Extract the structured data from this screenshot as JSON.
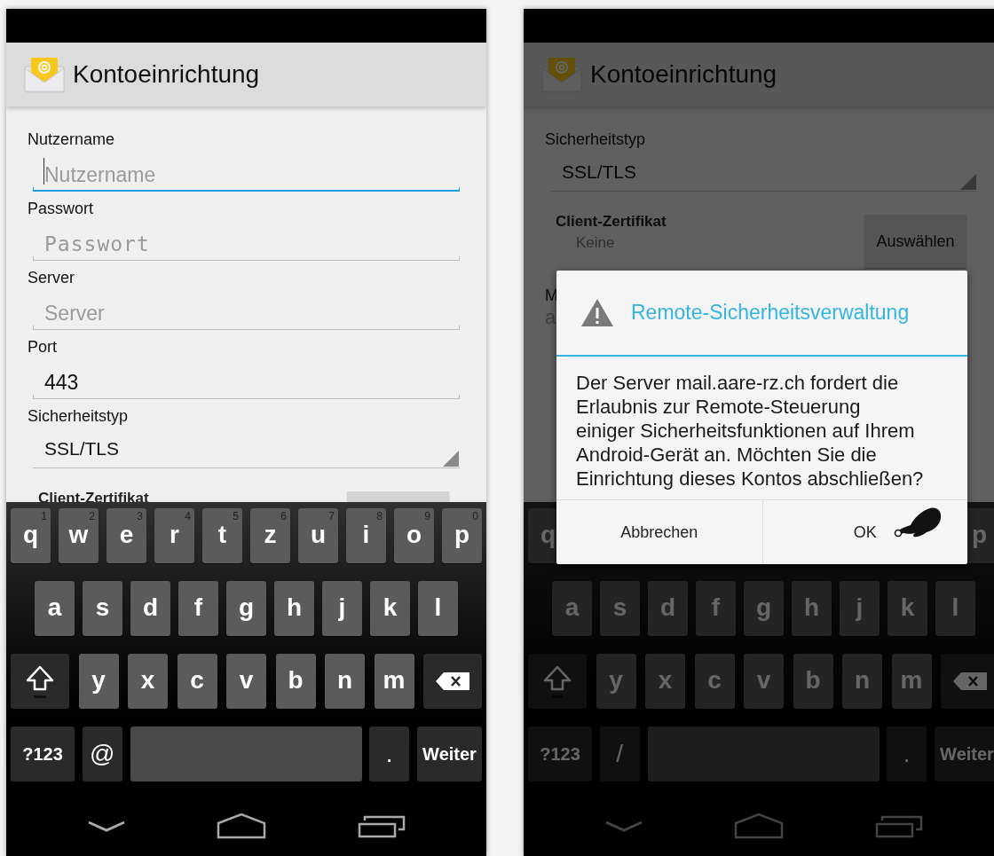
{
  "phones": [
    {
      "action_bar": {
        "title": "Kontoeinrichtung"
      },
      "form": {
        "fields": [
          {
            "kind": "text",
            "label": "Nutzername",
            "placeholder": "Nutzername",
            "focused": true
          },
          {
            "kind": "password",
            "label": "Passwort",
            "placeholder": "Passwort",
            "focused": false
          },
          {
            "kind": "text",
            "label": "Server",
            "placeholder": "Server",
            "focused": false
          },
          {
            "kind": "text",
            "label": "Port",
            "value": "443",
            "focused": false
          },
          {
            "kind": "spinner",
            "label": "Sicherheitstyp",
            "value": "SSL/TLS"
          },
          {
            "kind": "certificate",
            "label": "Client-Zertifikat"
          }
        ]
      },
      "keyboard": {
        "rows": [
          {
            "keys": [
              {
                "kind": "letter",
                "label": "q",
                "hint": "1"
              },
              {
                "kind": "letter",
                "label": "w",
                "hint": "2"
              },
              {
                "kind": "letter",
                "label": "e",
                "hint": "3"
              },
              {
                "kind": "letter",
                "label": "r",
                "hint": "4"
              },
              {
                "kind": "letter",
                "label": "t",
                "hint": "5"
              },
              {
                "kind": "letter",
                "label": "z",
                "hint": "6"
              },
              {
                "kind": "letter",
                "label": "u",
                "hint": "7"
              },
              {
                "kind": "letter",
                "label": "i",
                "hint": "8"
              },
              {
                "kind": "letter",
                "label": "o",
                "hint": "9"
              },
              {
                "kind": "letter",
                "label": "p",
                "hint": "0"
              }
            ]
          },
          {
            "keys": [
              {
                "kind": "letter",
                "label": "a"
              },
              {
                "kind": "letter",
                "label": "s"
              },
              {
                "kind": "letter",
                "label": "d"
              },
              {
                "kind": "letter",
                "label": "f"
              },
              {
                "kind": "letter",
                "label": "g"
              },
              {
                "kind": "letter",
                "label": "h"
              },
              {
                "kind": "letter",
                "label": "j"
              },
              {
                "kind": "letter",
                "label": "k"
              },
              {
                "kind": "letter",
                "label": "l"
              }
            ]
          },
          {
            "keys": [
              {
                "kind": "shift"
              },
              {
                "kind": "letter",
                "label": "y"
              },
              {
                "kind": "letter",
                "label": "x"
              },
              {
                "kind": "letter",
                "label": "c"
              },
              {
                "kind": "letter",
                "label": "v"
              },
              {
                "kind": "letter",
                "label": "b"
              },
              {
                "kind": "letter",
                "label": "n"
              },
              {
                "kind": "letter",
                "label": "m"
              },
              {
                "kind": "backspace"
              }
            ]
          },
          {
            "keys": [
              {
                "kind": "symbols",
                "label": "?123"
              },
              {
                "kind": "char",
                "label": "@"
              },
              {
                "kind": "space"
              },
              {
                "kind": "char",
                "label": "."
              },
              {
                "kind": "action",
                "label": "Weiter"
              }
            ]
          }
        ]
      }
    },
    {
      "action_bar": {
        "title": "Kontoeinrichtung"
      },
      "form": {
        "fields": [
          {
            "kind": "spinner",
            "label": "Sicherheitstyp",
            "value": "SSL/TLS"
          },
          {
            "kind": "certificate",
            "label": "Client-Zertifikat",
            "value": "Keine",
            "button": "Auswählen"
          },
          {
            "kind": "partial",
            "label": "M",
            "value": "a"
          }
        ]
      },
      "keyboard": {
        "rows": [
          {
            "keys": [
              {
                "kind": "letter",
                "label": "q"
              },
              {
                "kind": "letter",
                "label": "p"
              }
            ]
          },
          {
            "keys": [
              {
                "kind": "letter",
                "label": "a"
              },
              {
                "kind": "letter",
                "label": "s"
              },
              {
                "kind": "letter",
                "label": "d"
              },
              {
                "kind": "letter",
                "label": "f"
              },
              {
                "kind": "letter",
                "label": "g"
              },
              {
                "kind": "letter",
                "label": "h"
              },
              {
                "kind": "letter",
                "label": "j"
              },
              {
                "kind": "letter",
                "label": "k"
              },
              {
                "kind": "letter",
                "label": "l"
              }
            ]
          },
          {
            "keys": [
              {
                "kind": "shift"
              },
              {
                "kind": "letter",
                "label": "y"
              },
              {
                "kind": "letter",
                "label": "x"
              },
              {
                "kind": "letter",
                "label": "c"
              },
              {
                "kind": "letter",
                "label": "v"
              },
              {
                "kind": "letter",
                "label": "b"
              },
              {
                "kind": "letter",
                "label": "n"
              },
              {
                "kind": "letter",
                "label": "m"
              },
              {
                "kind": "backspace"
              }
            ]
          },
          {
            "keys": [
              {
                "kind": "symbols",
                "label": "?123"
              },
              {
                "kind": "char",
                "label": "/"
              },
              {
                "kind": "space"
              },
              {
                "kind": "char",
                "label": "."
              },
              {
                "kind": "action",
                "label": "Weiter"
              }
            ]
          }
        ]
      },
      "dialog": {
        "title": "Remote-Sicherheitsverwaltung",
        "message": "Der Server mail.aare-rz.ch fordert die Erlaubnis zur Remote-Steuerung einiger Sicherheitsfunktionen auf Ihrem Android-Gerät an. Möchten Sie die Einrichtung dieses Kontos abschließen?",
        "buttons": [
          {
            "label": "Abbrechen",
            "pointer": false
          },
          {
            "label": "OK",
            "pointer": true
          }
        ]
      }
    }
  ]
}
